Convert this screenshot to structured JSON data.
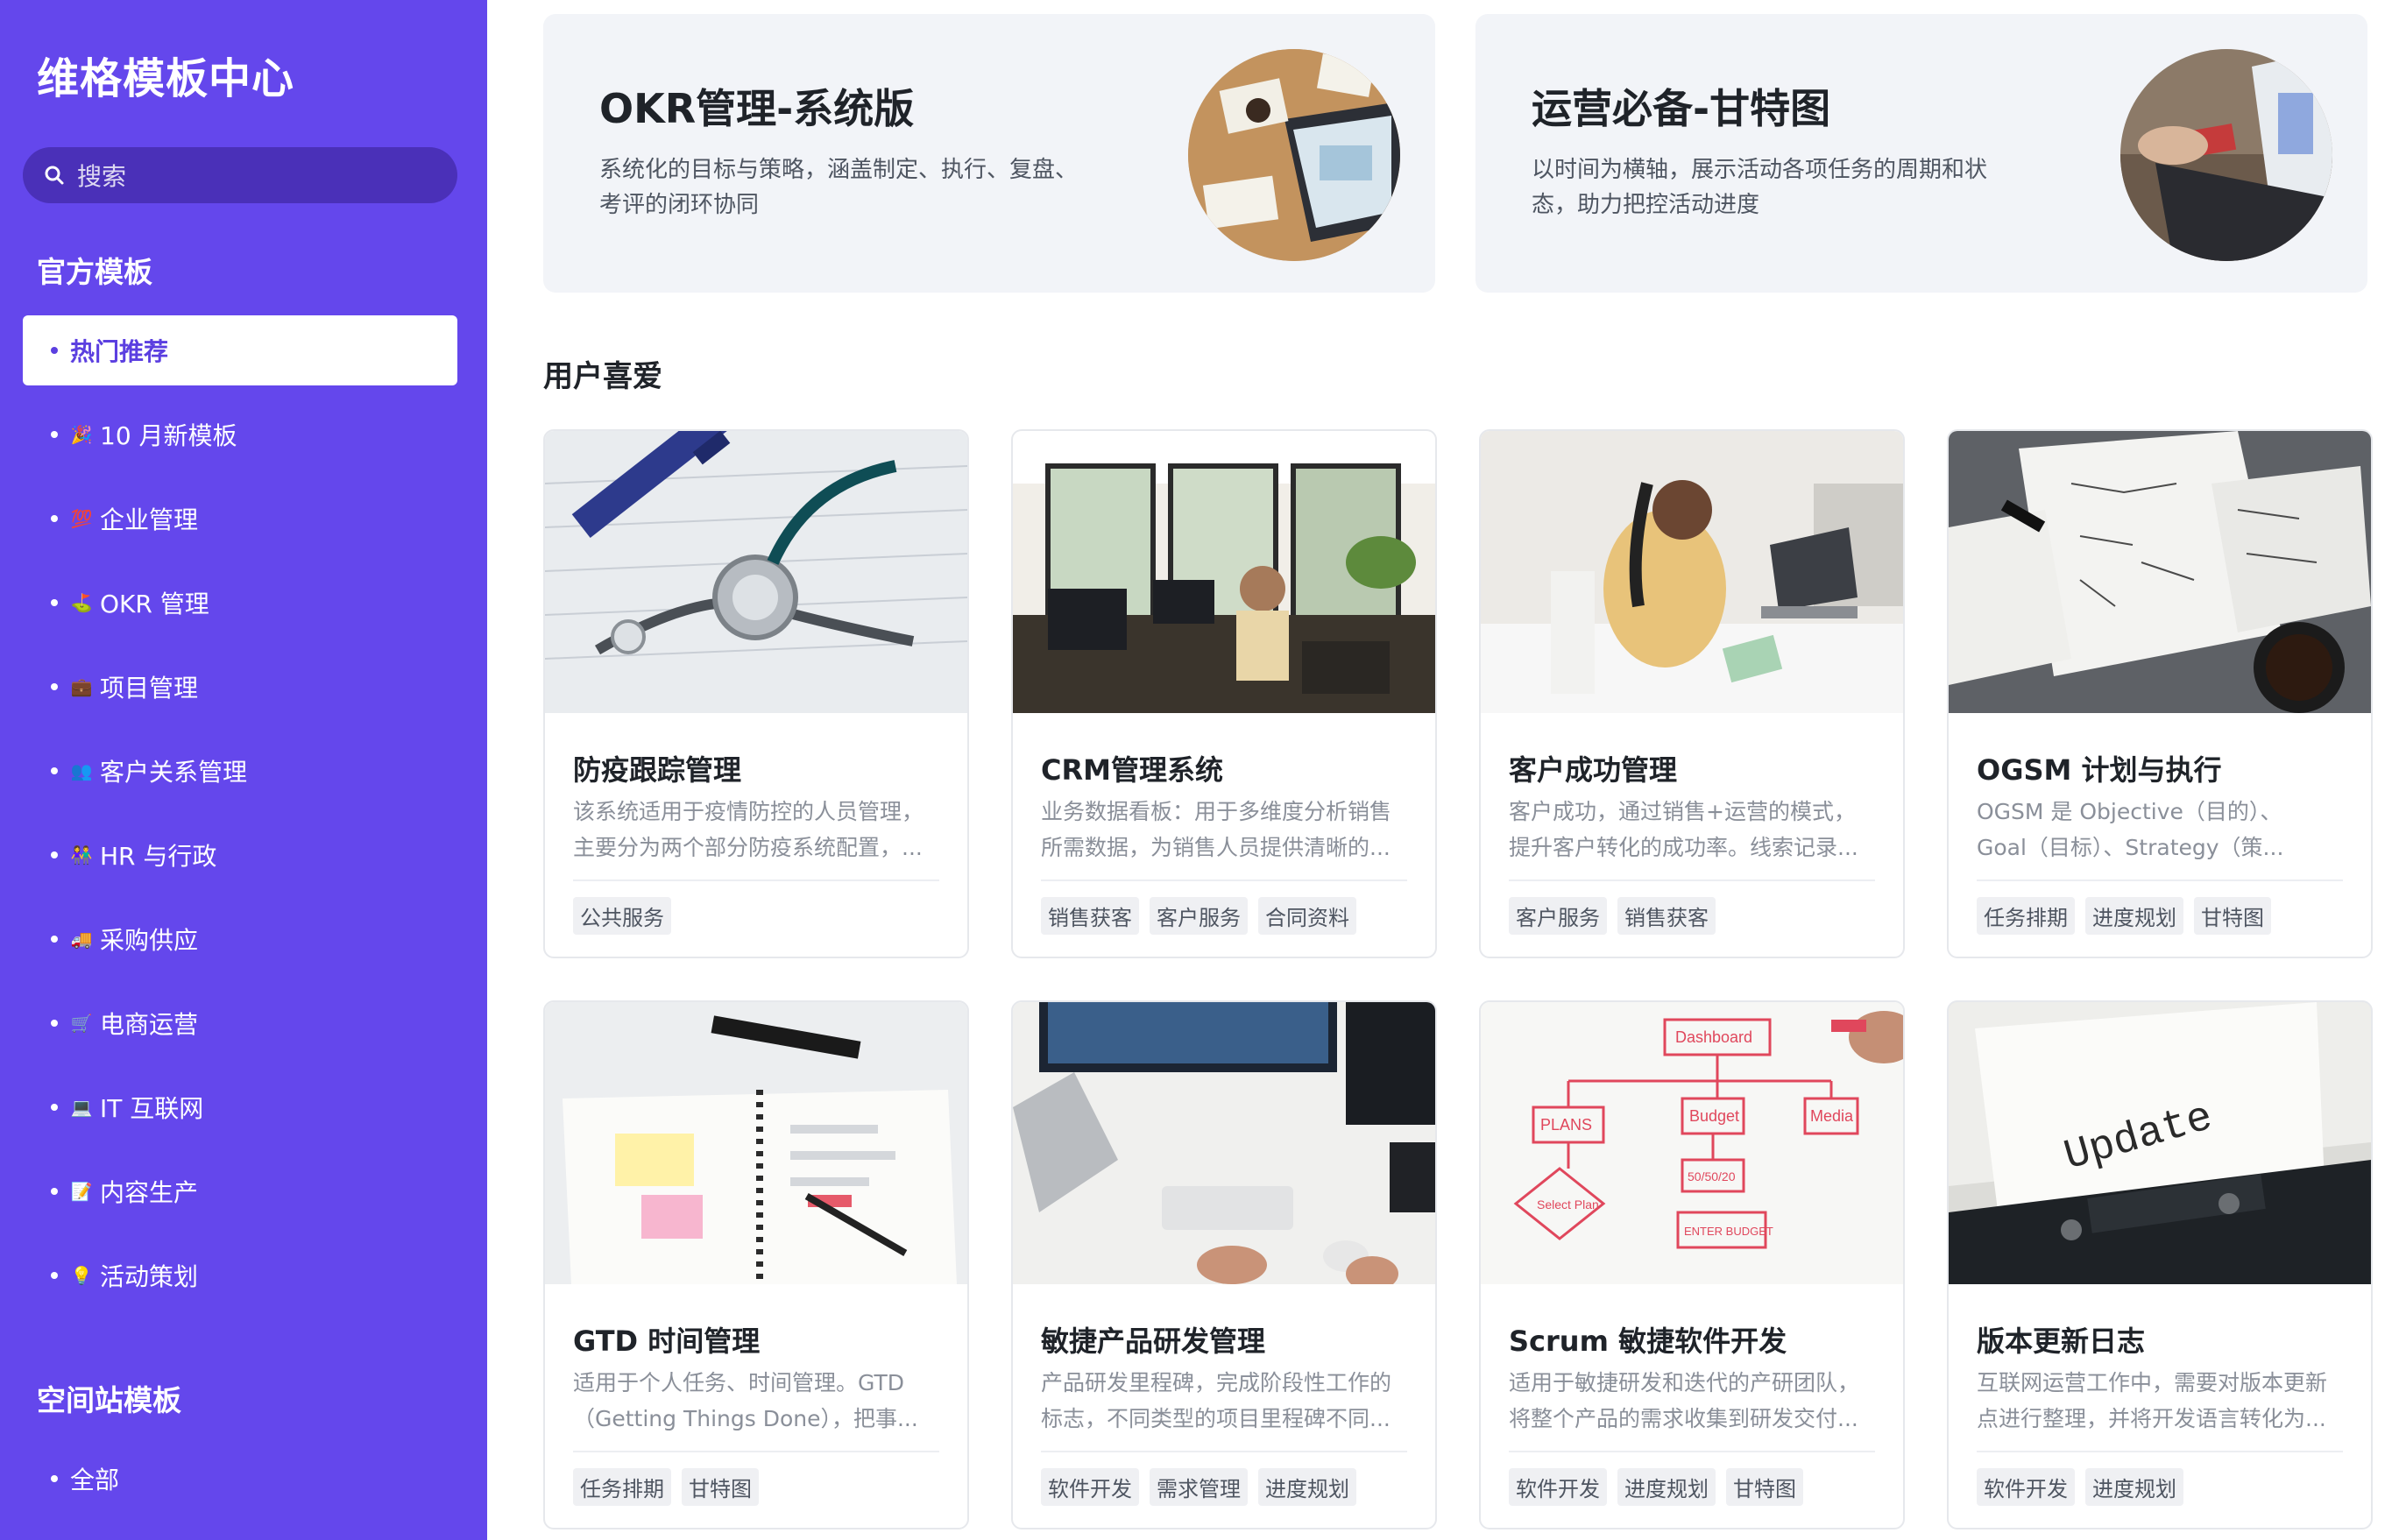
{
  "sidebar": {
    "brand": "维格模板中心",
    "search_placeholder": "搜索",
    "official_title": "官方模板",
    "items": [
      {
        "emoji": "",
        "label": "热门推荐",
        "active": true
      },
      {
        "emoji": "🎉",
        "label": "10 月新模板",
        "active": false
      },
      {
        "emoji": "💯",
        "label": "企业管理",
        "active": false
      },
      {
        "emoji": "⛳",
        "label": "OKR 管理",
        "active": false
      },
      {
        "emoji": "💼",
        "label": "项目管理",
        "active": false
      },
      {
        "emoji": "👥",
        "label": "客户关系管理",
        "active": false
      },
      {
        "emoji": "👫",
        "label": "HR 与行政",
        "active": false
      },
      {
        "emoji": "🚚",
        "label": "采购供应",
        "active": false
      },
      {
        "emoji": "🛒",
        "label": "电商运营",
        "active": false
      },
      {
        "emoji": "💻",
        "label": "IT 互联网",
        "active": false
      },
      {
        "emoji": "📝",
        "label": "内容生产",
        "active": false
      },
      {
        "emoji": "💡",
        "label": "活动策划",
        "active": false
      }
    ],
    "space_title": "空间站模板",
    "space_items": [
      {
        "label": "全部"
      }
    ]
  },
  "banners": [
    {
      "title": "OKR管理-系统版",
      "desc_lines": [
        "系统化的目标与策略，涵盖制定、执行、复盘、",
        "考评的闭环协同"
      ]
    },
    {
      "title": "运营必备-甘特图",
      "desc_lines": [
        "以时间为横轴，展示活动各项任务的周期和状",
        "态，助力把控活动进度"
      ]
    }
  ],
  "group_title": "用户喜爱",
  "cards": [
    {
      "title": "防疫跟踪管理",
      "desc": [
        "该系统适用于疫情防控的人员管理，",
        "主要分为两个部分防疫系统配置，..."
      ],
      "tags": [
        "公共服务"
      ]
    },
    {
      "title": "CRM管理系统",
      "desc": [
        "业务数据看板：用于多维度分析销售",
        "所需数据，为销售人员提供清晰的..."
      ],
      "tags": [
        "销售获客",
        "客户服务",
        "合同资料"
      ]
    },
    {
      "title": "客户成功管理",
      "desc": [
        "客户成功，通过销售+运营的模式，",
        "提升客户转化的成功率。线索记录..."
      ],
      "tags": [
        "客户服务",
        "销售获客"
      ]
    },
    {
      "title": "OGSM 计划与执行",
      "desc": [
        "OGSM 是 Objective（目的）、",
        "Goal（目标）、Strategy（策..."
      ],
      "tags": [
        "任务排期",
        "进度规划",
        "甘特图"
      ]
    },
    {
      "title": "GTD 时间管理",
      "desc": [
        "适用于个人任务、时间管理。GTD",
        "（Getting Things Done），把事..."
      ],
      "tags": [
        "任务排期",
        "甘特图"
      ]
    },
    {
      "title": "敏捷产品研发管理",
      "desc": [
        "产品研发里程碑，完成阶段性工作的",
        "标志，不同类型的项目里程碑不同..."
      ],
      "tags": [
        "软件开发",
        "需求管理",
        "进度规划"
      ]
    },
    {
      "title": "Scrum 敏捷软件开发",
      "desc": [
        "适用于敏捷研发和迭代的产研团队，",
        "将整个产品的需求收集到研发交付..."
      ],
      "tags": [
        "软件开发",
        "进度规划",
        "甘特图"
      ]
    },
    {
      "title": "版本更新日志",
      "desc": [
        "互联网运营工作中，需要对版本更新",
        "点进行整理，并将开发语言转化为..."
      ],
      "tags": [
        "软件开发",
        "进度规划"
      ]
    }
  ],
  "image_text": {
    "whiteboard_words": [
      "Dashboard",
      "PLANS",
      "Budget",
      "Media",
      "Select Plan",
      "50/50/20",
      "ENTER BUDGET"
    ],
    "typewriter_word": "Update"
  },
  "colors": {
    "accent": "#6447ec",
    "active_text": "#5b3fe0"
  }
}
